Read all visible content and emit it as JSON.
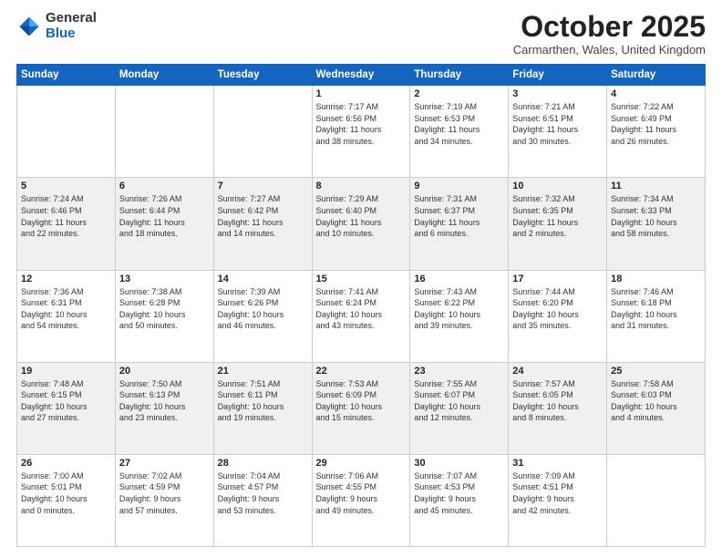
{
  "logo": {
    "general": "General",
    "blue": "Blue"
  },
  "header": {
    "month": "October 2025",
    "location": "Carmarthen, Wales, United Kingdom"
  },
  "weekdays": [
    "Sunday",
    "Monday",
    "Tuesday",
    "Wednesday",
    "Thursday",
    "Friday",
    "Saturday"
  ],
  "weeks": [
    [
      {
        "day": "",
        "info": ""
      },
      {
        "day": "",
        "info": ""
      },
      {
        "day": "",
        "info": ""
      },
      {
        "day": "1",
        "info": "Sunrise: 7:17 AM\nSunset: 6:56 PM\nDaylight: 11 hours\nand 38 minutes."
      },
      {
        "day": "2",
        "info": "Sunrise: 7:19 AM\nSunset: 6:53 PM\nDaylight: 11 hours\nand 34 minutes."
      },
      {
        "day": "3",
        "info": "Sunrise: 7:21 AM\nSunset: 6:51 PM\nDaylight: 11 hours\nand 30 minutes."
      },
      {
        "day": "4",
        "info": "Sunrise: 7:22 AM\nSunset: 6:49 PM\nDaylight: 11 hours\nand 26 minutes."
      }
    ],
    [
      {
        "day": "5",
        "info": "Sunrise: 7:24 AM\nSunset: 6:46 PM\nDaylight: 11 hours\nand 22 minutes."
      },
      {
        "day": "6",
        "info": "Sunrise: 7:26 AM\nSunset: 6:44 PM\nDaylight: 11 hours\nand 18 minutes."
      },
      {
        "day": "7",
        "info": "Sunrise: 7:27 AM\nSunset: 6:42 PM\nDaylight: 11 hours\nand 14 minutes."
      },
      {
        "day": "8",
        "info": "Sunrise: 7:29 AM\nSunset: 6:40 PM\nDaylight: 11 hours\nand 10 minutes."
      },
      {
        "day": "9",
        "info": "Sunrise: 7:31 AM\nSunset: 6:37 PM\nDaylight: 11 hours\nand 6 minutes."
      },
      {
        "day": "10",
        "info": "Sunrise: 7:32 AM\nSunset: 6:35 PM\nDaylight: 11 hours\nand 2 minutes."
      },
      {
        "day": "11",
        "info": "Sunrise: 7:34 AM\nSunset: 6:33 PM\nDaylight: 10 hours\nand 58 minutes."
      }
    ],
    [
      {
        "day": "12",
        "info": "Sunrise: 7:36 AM\nSunset: 6:31 PM\nDaylight: 10 hours\nand 54 minutes."
      },
      {
        "day": "13",
        "info": "Sunrise: 7:38 AM\nSunset: 6:28 PM\nDaylight: 10 hours\nand 50 minutes."
      },
      {
        "day": "14",
        "info": "Sunrise: 7:39 AM\nSunset: 6:26 PM\nDaylight: 10 hours\nand 46 minutes."
      },
      {
        "day": "15",
        "info": "Sunrise: 7:41 AM\nSunset: 6:24 PM\nDaylight: 10 hours\nand 43 minutes."
      },
      {
        "day": "16",
        "info": "Sunrise: 7:43 AM\nSunset: 6:22 PM\nDaylight: 10 hours\nand 39 minutes."
      },
      {
        "day": "17",
        "info": "Sunrise: 7:44 AM\nSunset: 6:20 PM\nDaylight: 10 hours\nand 35 minutes."
      },
      {
        "day": "18",
        "info": "Sunrise: 7:46 AM\nSunset: 6:18 PM\nDaylight: 10 hours\nand 31 minutes."
      }
    ],
    [
      {
        "day": "19",
        "info": "Sunrise: 7:48 AM\nSunset: 6:15 PM\nDaylight: 10 hours\nand 27 minutes."
      },
      {
        "day": "20",
        "info": "Sunrise: 7:50 AM\nSunset: 6:13 PM\nDaylight: 10 hours\nand 23 minutes."
      },
      {
        "day": "21",
        "info": "Sunrise: 7:51 AM\nSunset: 6:11 PM\nDaylight: 10 hours\nand 19 minutes."
      },
      {
        "day": "22",
        "info": "Sunrise: 7:53 AM\nSunset: 6:09 PM\nDaylight: 10 hours\nand 15 minutes."
      },
      {
        "day": "23",
        "info": "Sunrise: 7:55 AM\nSunset: 6:07 PM\nDaylight: 10 hours\nand 12 minutes."
      },
      {
        "day": "24",
        "info": "Sunrise: 7:57 AM\nSunset: 6:05 PM\nDaylight: 10 hours\nand 8 minutes."
      },
      {
        "day": "25",
        "info": "Sunrise: 7:58 AM\nSunset: 6:03 PM\nDaylight: 10 hours\nand 4 minutes."
      }
    ],
    [
      {
        "day": "26",
        "info": "Sunrise: 7:00 AM\nSunset: 5:01 PM\nDaylight: 10 hours\nand 0 minutes."
      },
      {
        "day": "27",
        "info": "Sunrise: 7:02 AM\nSunset: 4:59 PM\nDaylight: 9 hours\nand 57 minutes."
      },
      {
        "day": "28",
        "info": "Sunrise: 7:04 AM\nSunset: 4:57 PM\nDaylight: 9 hours\nand 53 minutes."
      },
      {
        "day": "29",
        "info": "Sunrise: 7:06 AM\nSunset: 4:55 PM\nDaylight: 9 hours\nand 49 minutes."
      },
      {
        "day": "30",
        "info": "Sunrise: 7:07 AM\nSunset: 4:53 PM\nDaylight: 9 hours\nand 45 minutes."
      },
      {
        "day": "31",
        "info": "Sunrise: 7:09 AM\nSunset: 4:51 PM\nDaylight: 9 hours\nand 42 minutes."
      },
      {
        "day": "",
        "info": ""
      }
    ]
  ]
}
